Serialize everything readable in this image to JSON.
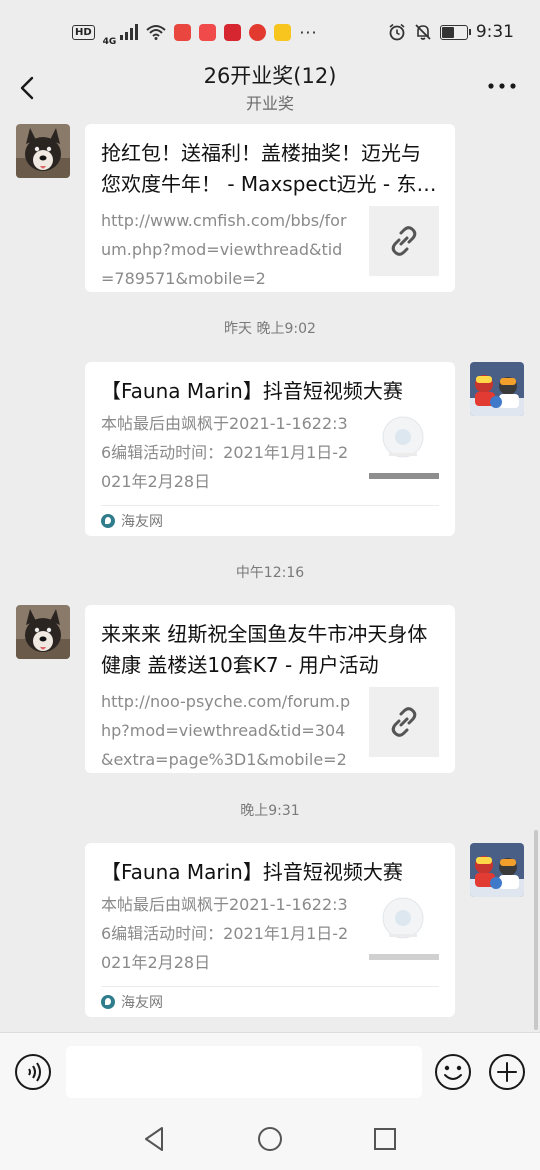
{
  "status_bar": {
    "hd": "HD",
    "network": "4G",
    "more": "···",
    "time": "9:31",
    "battery_level": 0.55
  },
  "nav": {
    "title": "26开业奖(12)",
    "subtitle": "开业奖"
  },
  "messages": [
    {
      "type": "link",
      "title": "抢红包！送福利！盖楼抽奖！迈光与您欢度牛年！ - Maxspect迈光 - 东方水族 - Powered by Discuz!",
      "desc": "http://www.cmfish.com/bbs/forum.php?mod=viewthread&tid=789571&mobile=2"
    },
    {
      "type": "timestamp",
      "text": "昨天 晚上9:02"
    },
    {
      "type": "article",
      "title": "【Fauna Marin】抖音短视频大赛",
      "desc": "本帖最后由飒枫于2021-1-1622:36编辑活动时间：2021年1月1日-2021年2月28日",
      "source": "海友网"
    },
    {
      "type": "timestamp",
      "text": "中午12:16"
    },
    {
      "type": "link",
      "title": "来来来 纽斯祝全国鱼友牛市冲天身体健康 盖楼送10套K7 - 用户活动",
      "desc": "http://noo-psyche.com/forum.php?mod=viewthread&tid=304&extra=page%3D1&mobile=2"
    },
    {
      "type": "timestamp",
      "text": "晚上9:31"
    },
    {
      "type": "article",
      "title": "【Fauna Marin】抖音短视频大赛",
      "desc": "本帖最后由飒枫于2021-1-1622:36编辑活动时间：2021年1月1日-2021年2月28日",
      "source": "海友网"
    }
  ],
  "input": {
    "placeholder": ""
  },
  "colors": {
    "background": "#ededed",
    "card": "#ffffff",
    "meta_text": "#7a7a7a"
  },
  "icons": [
    "back-arrow-icon",
    "more-icon",
    "link-icon",
    "voice-icon",
    "emoji-icon",
    "plus-icon",
    "nav-back-icon",
    "nav-home-icon",
    "nav-recents-icon"
  ]
}
